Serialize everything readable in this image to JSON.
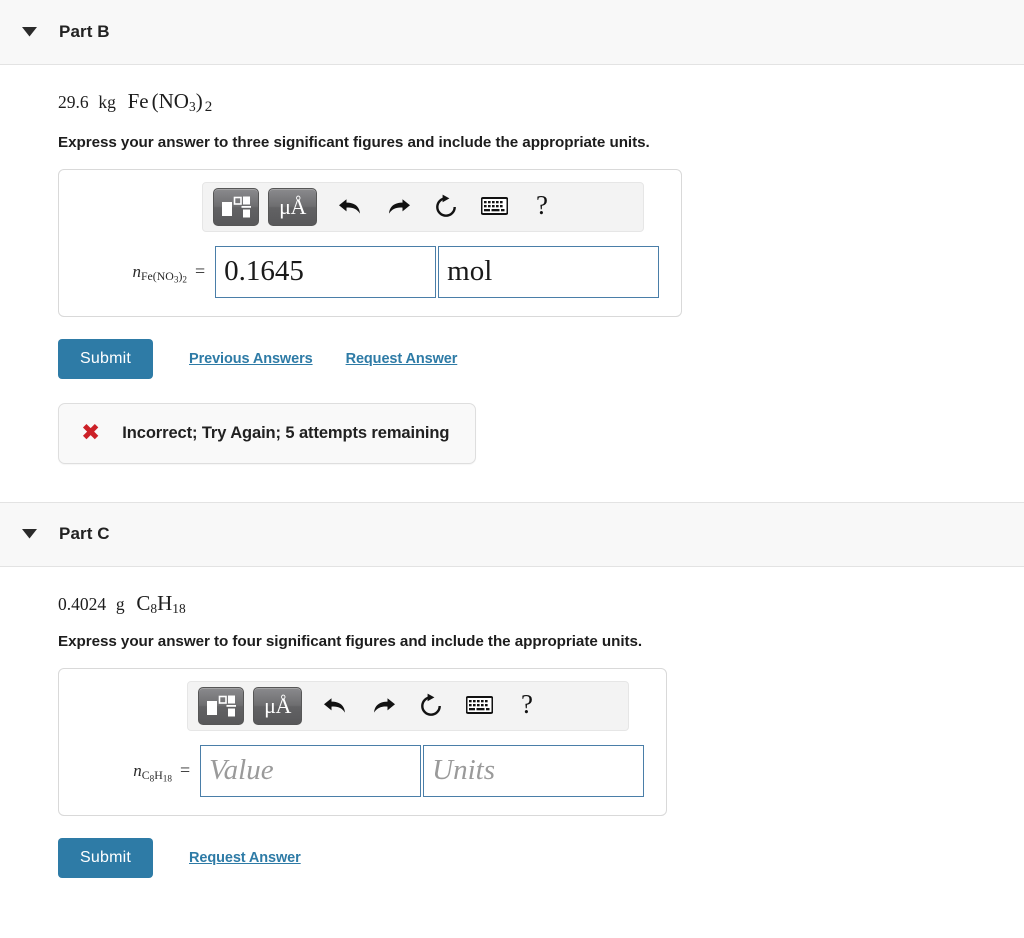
{
  "parts": [
    {
      "id": "part-b",
      "title": "Part B",
      "quantity": "29.6",
      "quantity_unit": "kg",
      "compound_main": "Fe",
      "compound_paren_open": "(",
      "compound_inner": "NO",
      "compound_inner_sub": "3",
      "compound_paren_close": ")",
      "compound_outer_sub": "2",
      "instruction": "Express your answer to three significant figures and include the appropriate units.",
      "var_symbol": "n",
      "var_sub": "Fe(NO3)2",
      "equals": "=",
      "value": "0.1645",
      "units": "mol",
      "value_is_placeholder": false,
      "submit_label": "Submit",
      "links": [
        "Previous Answers",
        "Request Answer"
      ],
      "feedback": {
        "icon": "x-mark-icon",
        "text": "Incorrect; Try Again; 5 attempts remaining",
        "color": "#cc2128"
      }
    },
    {
      "id": "part-c",
      "title": "Part C",
      "quantity": "0.4024",
      "quantity_unit": "g",
      "compound_main": "C",
      "compound_main_sub": "8",
      "compound_second": "H",
      "compound_second_sub": "18",
      "instruction": "Express your answer to four significant figures and include the appropriate units.",
      "var_symbol": "n",
      "var_sub": "C8H18",
      "equals": "=",
      "value": "Value",
      "units": "Units",
      "value_is_placeholder": true,
      "submit_label": "Submit",
      "links": [
        "Request Answer"
      ],
      "feedback": null
    }
  ],
  "toolbar": {
    "buttons": [
      {
        "name": "math-template-icon",
        "label": ""
      },
      {
        "name": "unit-symbol-icon",
        "label": "μÅ"
      },
      {
        "name": "undo-icon",
        "label": ""
      },
      {
        "name": "redo-icon",
        "label": ""
      },
      {
        "name": "reset-icon",
        "label": ""
      },
      {
        "name": "keyboard-icon",
        "label": ""
      },
      {
        "name": "help-icon",
        "label": "?"
      }
    ],
    "help_glyph": "?",
    "unit_glyph": "μÅ"
  },
  "colors": {
    "accent": "#2e7ba6",
    "header_bg": "#f8f8f8",
    "field_border": "#4a7ea8",
    "error": "#cc2128"
  }
}
